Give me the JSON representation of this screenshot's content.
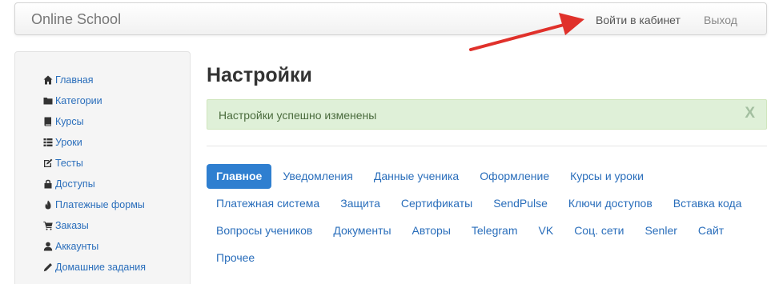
{
  "navbar": {
    "brand": "Online School",
    "cabinet_link": "Войти в кабинет",
    "exit_link": "Выход"
  },
  "sidebar": {
    "items": [
      {
        "label": "Главная",
        "icon": "home-icon"
      },
      {
        "label": "Категории",
        "icon": "folder-icon"
      },
      {
        "label": "Курсы",
        "icon": "book-icon"
      },
      {
        "label": "Уроки",
        "icon": "list-icon"
      },
      {
        "label": "Тесты",
        "icon": "edit-icon"
      },
      {
        "label": "Доступы",
        "icon": "lock-icon"
      },
      {
        "label": "Платежные формы",
        "icon": "fire-icon"
      },
      {
        "label": "Заказы",
        "icon": "cart-icon"
      },
      {
        "label": "Аккаунты",
        "icon": "user-icon"
      },
      {
        "label": "Домашние задания",
        "icon": "pencil-icon"
      }
    ]
  },
  "main": {
    "title": "Настройки",
    "alert": {
      "text": "Настройки успешно изменены",
      "close": "X"
    },
    "tabs": [
      {
        "label": "Главное",
        "active": true
      },
      {
        "label": "Уведомления"
      },
      {
        "label": "Данные ученика"
      },
      {
        "label": "Оформление"
      },
      {
        "label": "Курсы и уроки"
      },
      {
        "label": "Платежная система"
      },
      {
        "label": "Защита"
      },
      {
        "label": "Сертификаты"
      },
      {
        "label": "SendPulse"
      },
      {
        "label": "Ключи доступов"
      },
      {
        "label": "Вставка кода"
      },
      {
        "label": "Вопросы учеников"
      },
      {
        "label": "Документы"
      },
      {
        "label": "Авторы"
      },
      {
        "label": "Telegram"
      },
      {
        "label": "VK"
      },
      {
        "label": "Соц. сети"
      },
      {
        "label": "Senler"
      },
      {
        "label": "Сайт"
      },
      {
        "label": "Прочее"
      }
    ]
  },
  "colors": {
    "link": "#2a6ebb",
    "active_tab": "#2f7fd0",
    "alert_bg": "#dff0d8",
    "annotation_arrow": "#e0312b"
  }
}
